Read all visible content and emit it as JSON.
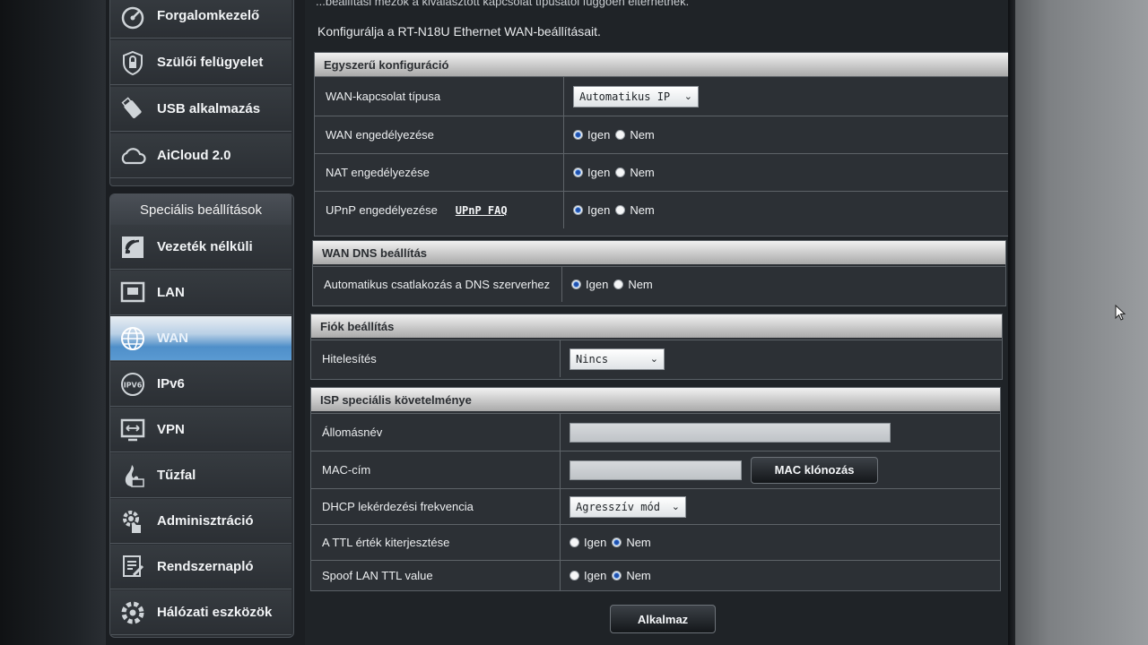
{
  "sidebar": {
    "top_items": [
      {
        "label": "Forgalomkezelő",
        "icon": "gauge-icon"
      },
      {
        "label": "Szülői felügyelet",
        "icon": "shield-lock-icon"
      },
      {
        "label": "USB alkalmazás",
        "icon": "usb-icon"
      },
      {
        "label": "AiCloud 2.0",
        "icon": "cloud-icon"
      }
    ],
    "advanced_title": "Speciális beállítások",
    "advanced_items": [
      {
        "label": "Vezeték nélküli",
        "icon": "wireless-icon"
      },
      {
        "label": "LAN",
        "icon": "lan-monitor-icon"
      },
      {
        "label": "WAN",
        "icon": "globe-icon",
        "active": true
      },
      {
        "label": "IPv6",
        "icon": "ipv6-icon"
      },
      {
        "label": "VPN",
        "icon": "vpn-icon"
      },
      {
        "label": "Tűzfal",
        "icon": "firewall-icon"
      },
      {
        "label": "Adminisztráció",
        "icon": "admin-gear-icon"
      },
      {
        "label": "Rendszernapló",
        "icon": "log-icon"
      },
      {
        "label": "Hálózati eszközök",
        "icon": "network-tools-icon"
      }
    ]
  },
  "main": {
    "top_note": "...beállítási mezők a kiválasztott kapcsolat típusától függően eltérhetnek.",
    "subtitle": "Konfigurálja a RT-N18U Ethernet WAN-beállításait.",
    "basic": {
      "title": "Egyszerű konfiguráció",
      "wan_type_label": "WAN-kapcsolat típusa",
      "wan_type_value": "Automatikus IP",
      "wan_enable_label": "WAN engedélyezése",
      "nat_enable_label": "NAT engedélyezése",
      "upnp_enable_label": "UPnP engedélyezése",
      "upnp_faq": "UPnP FAQ"
    },
    "radio": {
      "yes": "Igen",
      "no": "Nem"
    },
    "dns": {
      "title": "WAN DNS beállítás",
      "auto_dns_label": "Automatikus csatlakozás a DNS szerverhez"
    },
    "account": {
      "title": "Fiók beállítás",
      "auth_label": "Hitelesítés",
      "auth_value": "Nincs"
    },
    "isp": {
      "title": "ISP speciális követelménye",
      "hostname_label": "Állomásnév",
      "hostname_value": "",
      "mac_label": "MAC-cím",
      "mac_value": "",
      "mac_clone_button": "MAC klónozás",
      "dhcp_freq_label": "DHCP lekérdezési frekvencia",
      "dhcp_freq_value": "Agresszív mód",
      "ttl_label": "A TTL érték kiterjesztése",
      "spoof_ttl_label": "Spoof LAN TTL value"
    },
    "apply_button": "Alkalmaz"
  },
  "colors": {
    "active_nav": "#5a9ad2",
    "panel_header": "#c9c9c9",
    "radio_selected": "#1e4fae"
  }
}
